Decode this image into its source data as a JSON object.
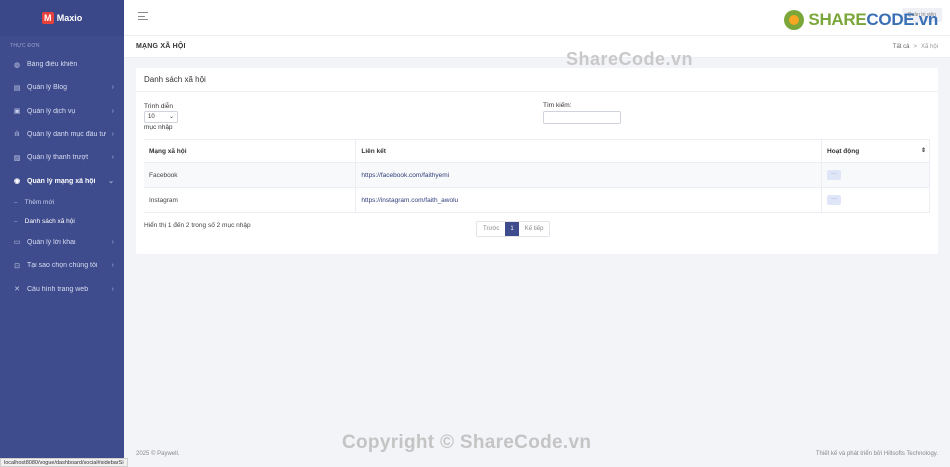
{
  "brand": {
    "name": "Maxio",
    "logo_letter": "M"
  },
  "sidebar": {
    "heading": "THỰC ĐƠN",
    "items": [
      {
        "icon": "dashboard-icon",
        "glyph": "◍",
        "label": "Bảng điều khiển",
        "has_chevron": false
      },
      {
        "icon": "blog-icon",
        "glyph": "▤",
        "label": "Quản lý Blog",
        "chevron": "›"
      },
      {
        "icon": "services-icon",
        "glyph": "▣",
        "label": "Quản lý dịch vụ",
        "chevron": "›"
      },
      {
        "icon": "chart-icon",
        "glyph": "ılı",
        "label": "Quản lý danh mục đầu tư",
        "chevron": "›"
      },
      {
        "icon": "image-icon",
        "glyph": "▨",
        "label": "Quản lý thanh trượt",
        "chevron": "›"
      },
      {
        "icon": "social-icon",
        "glyph": "◉",
        "label": "Quản lý mạng xã hội",
        "chevron": "⌄"
      },
      {
        "icon": "message-icon",
        "glyph": "▭",
        "label": "Quản lý lời khai",
        "chevron": "›"
      },
      {
        "icon": "lock-icon",
        "glyph": "⊡",
        "label": "Tại sao chọn chúng tôi",
        "chevron": "›"
      },
      {
        "icon": "tools-icon",
        "glyph": "✕",
        "label": "Cấu hình trang web",
        "chevron": "›"
      }
    ],
    "sub_items": [
      {
        "label": "Thêm mới"
      },
      {
        "label": "Danh sách xã hội"
      }
    ]
  },
  "topbar": {
    "user_label": "Quản trị viên"
  },
  "watermark": {
    "brand_share": "SHARE",
    "brand_code": "CODE.vn",
    "center": "ShareCode.vn",
    "bottom": "Copyright © ShareCode.vn"
  },
  "page": {
    "title": "MẠNG XÃ HỘI",
    "breadcrumb": {
      "root": "Tất cả",
      "sep": ">",
      "current": "Xã hội"
    }
  },
  "card": {
    "title": "Danh sách xã hội",
    "show_label": "Trình diễn",
    "show_value": "10",
    "entries_label": "mục nhập",
    "search_label": "Tìm kiếm:",
    "search_value": "",
    "columns": [
      "Mạng xã hội",
      "Liên kết",
      "Hoạt động"
    ],
    "rows": [
      {
        "network": "Facebook",
        "link": "https://facebook.com/faithyemi",
        "action": "···"
      },
      {
        "network": "Instagram",
        "link": "https://instagram.com/faith_awolu",
        "action": "···"
      }
    ],
    "info": "Hiển thị 1 đến 2 trong số 2 mục nhập",
    "pager": {
      "prev": "Trước",
      "page": "1",
      "next": "Kế tiếp"
    }
  },
  "footer": {
    "left": "2025 © Paywell.",
    "right": "Thiết kế và phát triển bởi Hillsofts Technology."
  },
  "status_url": "localhost8080/vogue/dashboard/social#sidebarSi",
  "colors": {
    "sidebar": "#3e4b8c",
    "accent": "#3e4b8c",
    "background": "#f3f4f8"
  }
}
